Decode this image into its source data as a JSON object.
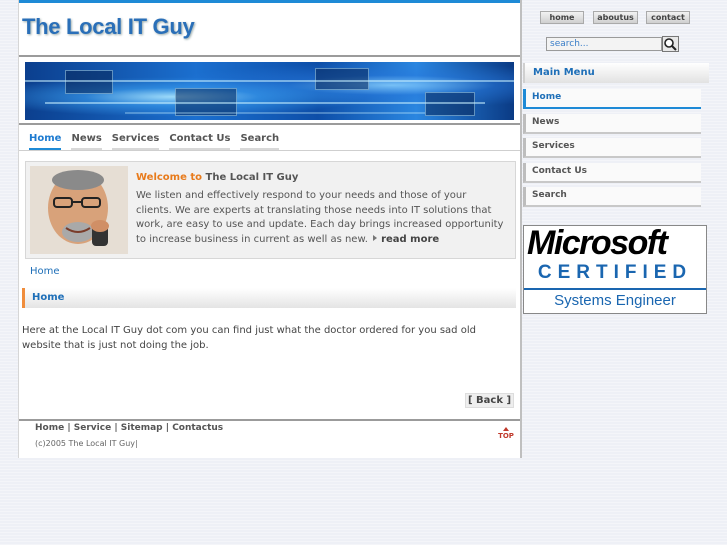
{
  "site": {
    "title": "The Local IT Guy"
  },
  "top_links": [
    "home",
    "aboutus",
    "contact"
  ],
  "search": {
    "value": "search...",
    "button_icon": "search-magnifier-icon"
  },
  "nav": [
    "Home",
    "News",
    "Services",
    "Contact Us",
    "Search"
  ],
  "welcome": {
    "prefix": "Welcome to",
    "name": "The Local IT Guy",
    "text": "We listen and effectively respond to your needs and those of your clients. We are experts at translating those needs into IT solutions that work, are easy to use and update. Each day brings increased opportunity to increase business in current as well as new.",
    "read_more": "read more"
  },
  "breadcrumb": "Home",
  "section": {
    "title": "Home",
    "body": "Here at the Local IT Guy dot com you can find just what the doctor ordered for you sad old website that is just not doing the job.",
    "back_label": "[ Back ]"
  },
  "footer": {
    "links": [
      "Home",
      "Service",
      "Sitemap",
      "Contactus"
    ],
    "separator": " | ",
    "copyright": "(c)2005 The Local IT Guy|",
    "top_label": "TOP"
  },
  "sidebar": {
    "menu_title": "Main Menu",
    "items": [
      "Home",
      "News",
      "Services",
      "Contact Us",
      "Search"
    ]
  },
  "badge": {
    "line1": "Microsoft",
    "line2": "CERTIFIED",
    "line3": "Systems Engineer"
  },
  "colors": {
    "accent_blue": "#1e8ad6",
    "title_blue": "#2a6fb8",
    "accent_orange": "#e87b1c"
  }
}
